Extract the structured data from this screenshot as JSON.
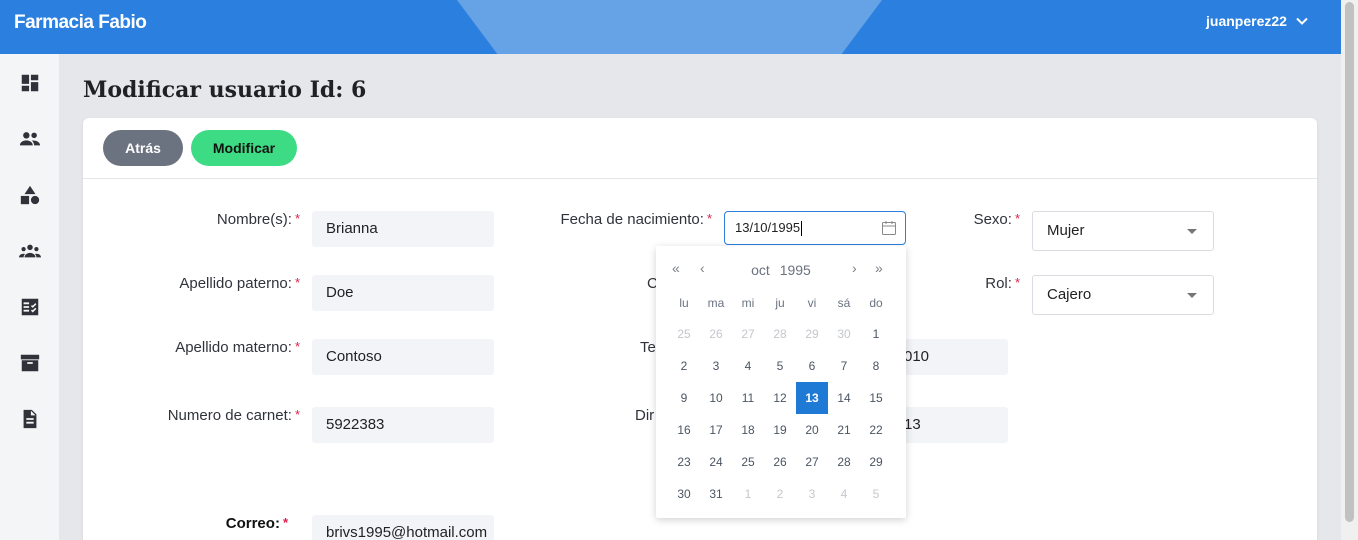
{
  "header": {
    "brand": "Farmacia Fabio",
    "username": "juanperez22",
    "colors": {
      "primary": "#2b80df",
      "accent_wedge": "#66a3e6"
    }
  },
  "sidebar": {
    "items": [
      {
        "icon": "dashboard-icon"
      },
      {
        "icon": "users-icon"
      },
      {
        "icon": "shapes-icon"
      },
      {
        "icon": "group-icon"
      },
      {
        "icon": "checklist-icon"
      },
      {
        "icon": "archive-icon"
      },
      {
        "icon": "document-icon"
      }
    ]
  },
  "page": {
    "title": "Modificar usuario Id: 6"
  },
  "toolbar": {
    "back_label": "Atrás",
    "modify_label": "Modificar"
  },
  "form": {
    "nombres_label": "Nombre(s):",
    "nombres_value": "Brianna",
    "apellido_paterno_label": "Apellido paterno:",
    "apellido_paterno_value": "Doe",
    "apellido_materno_label": "Apellido materno:",
    "apellido_materno_value": "Contoso",
    "carnet_label": "Numero de carnet:",
    "carnet_value": "5922383",
    "correo_label": "Correo:",
    "correo_value": "brivs1995@hotmail.com",
    "fecha_label": "Fecha de nacimiento:",
    "fecha_value": "13/10/1995",
    "partial_label_1": "C",
    "partial_label_2": "Te",
    "partial_value_2": "010",
    "partial_label_3": "Dir",
    "partial_value_3": "13",
    "sexo_label": "Sexo:",
    "sexo_value": "Mujer",
    "rol_label": "Rol:",
    "rol_value": "Cajero",
    "required_mark": "*"
  },
  "datepicker": {
    "month": "oct",
    "year": "1995",
    "prev_year": "«",
    "prev_month": "‹",
    "next_month": "›",
    "next_year": "»",
    "weekdays": [
      "lu",
      "ma",
      "mi",
      "ju",
      "vi",
      "sá",
      "do"
    ],
    "days": [
      {
        "d": "25",
        "muted": true
      },
      {
        "d": "26",
        "muted": true
      },
      {
        "d": "27",
        "muted": true
      },
      {
        "d": "28",
        "muted": true
      },
      {
        "d": "29",
        "muted": true
      },
      {
        "d": "30",
        "muted": true
      },
      {
        "d": "1"
      },
      {
        "d": "2"
      },
      {
        "d": "3"
      },
      {
        "d": "4"
      },
      {
        "d": "5"
      },
      {
        "d": "6"
      },
      {
        "d": "7"
      },
      {
        "d": "8"
      },
      {
        "d": "9"
      },
      {
        "d": "10"
      },
      {
        "d": "11"
      },
      {
        "d": "12"
      },
      {
        "d": "13",
        "selected": true
      },
      {
        "d": "14"
      },
      {
        "d": "15"
      },
      {
        "d": "16"
      },
      {
        "d": "17"
      },
      {
        "d": "18"
      },
      {
        "d": "19"
      },
      {
        "d": "20"
      },
      {
        "d": "21"
      },
      {
        "d": "22"
      },
      {
        "d": "23"
      },
      {
        "d": "24"
      },
      {
        "d": "25"
      },
      {
        "d": "26"
      },
      {
        "d": "27"
      },
      {
        "d": "28"
      },
      {
        "d": "29"
      },
      {
        "d": "30"
      },
      {
        "d": "31"
      },
      {
        "d": "1",
        "muted": true
      },
      {
        "d": "2",
        "muted": true
      },
      {
        "d": "3",
        "muted": true
      },
      {
        "d": "4",
        "muted": true
      },
      {
        "d": "5",
        "muted": true
      }
    ]
  }
}
